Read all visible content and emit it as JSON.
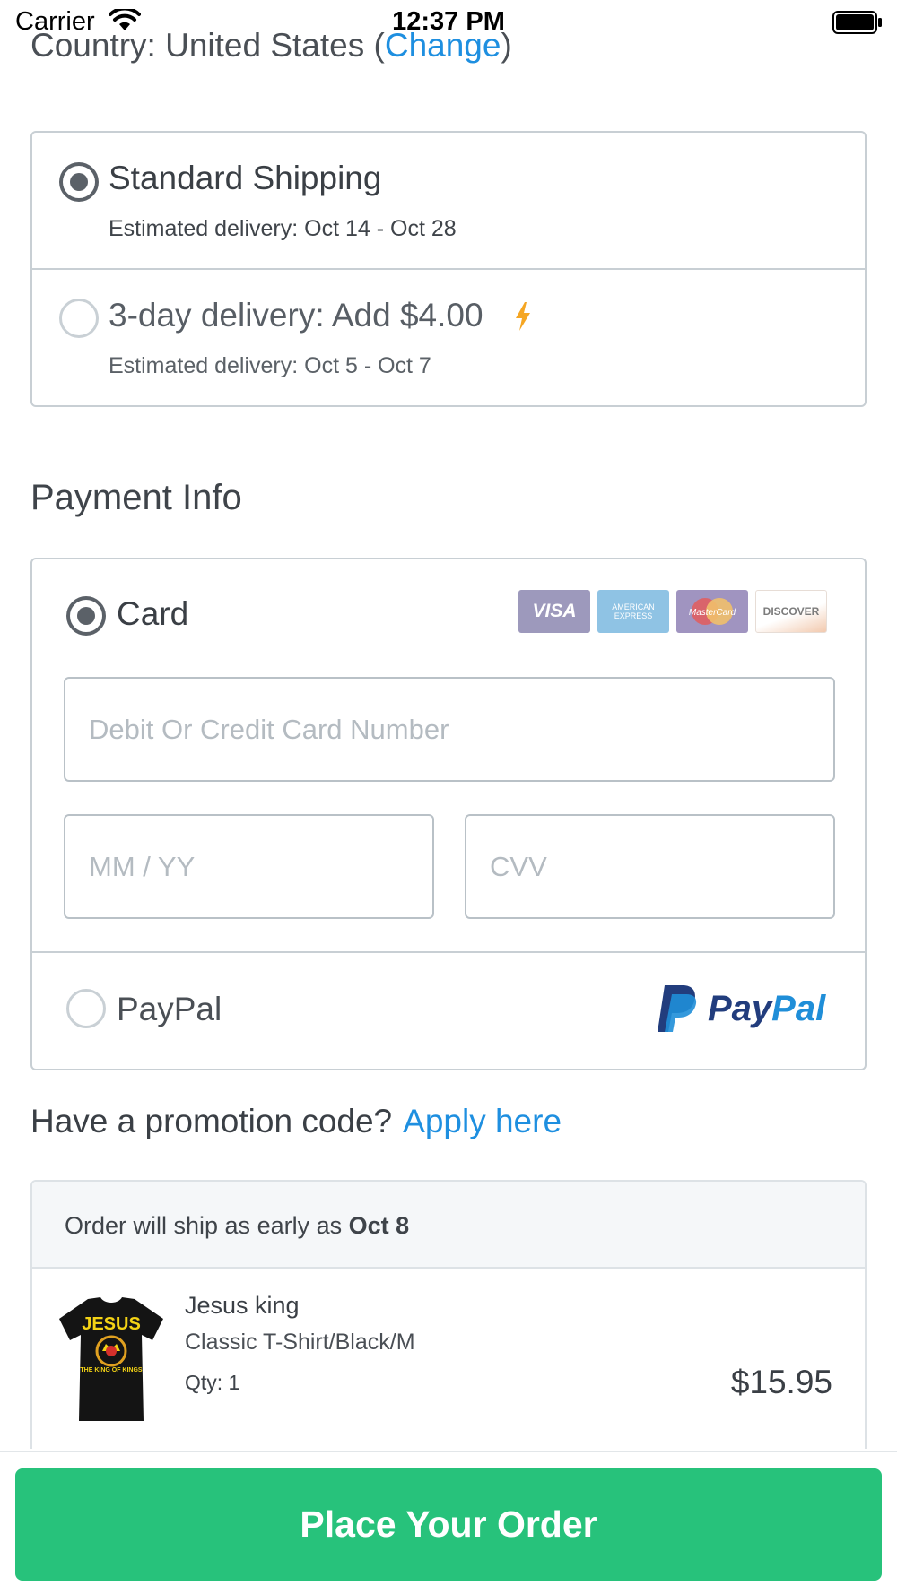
{
  "status_bar": {
    "carrier": "Carrier",
    "time": "12:37 PM"
  },
  "country": {
    "prefix": "Country: United States (",
    "change_link": "Change",
    "suffix": ")"
  },
  "shipping": {
    "options": [
      {
        "title": "Standard Shipping",
        "subtitle": "Estimated delivery: Oct 14 - Oct 28",
        "selected": true
      },
      {
        "title": "3-day delivery: Add $4.00",
        "subtitle": "Estimated delivery: Oct 5 - Oct 7",
        "selected": false
      }
    ],
    "bolt_color": "#f5a623"
  },
  "payment": {
    "title": "Payment Info",
    "card_label": "Card",
    "card_logos": [
      "VISA",
      "AMERICAN EXPRESS",
      "MasterCard",
      "DISCOVER"
    ],
    "card_number_placeholder": "Debit Or Credit Card Number",
    "expiry_placeholder": "MM / YY",
    "cvv_placeholder": "CVV",
    "paypal_label": "PayPal",
    "paypal_logo_pay": "Pay",
    "paypal_logo_pal": "Pal"
  },
  "promo": {
    "question": "Have a promotion code?",
    "link": "Apply here"
  },
  "order": {
    "ship_text": "Order will ship as early as",
    "ship_date": "Oct 8",
    "item": {
      "name": "Jesus king",
      "variant": "Classic T-Shirt/Black/M",
      "qty": "Qty: 1",
      "price": "$15.95",
      "shirt_text_top": "JESUS",
      "shirt_text_bottom": "THE KING OF KINGS"
    }
  },
  "cta": {
    "label": "Place Your Order",
    "color": "#27c27b"
  },
  "colors": {
    "link": "#1e8fe0",
    "border": "#c8cfd4"
  }
}
